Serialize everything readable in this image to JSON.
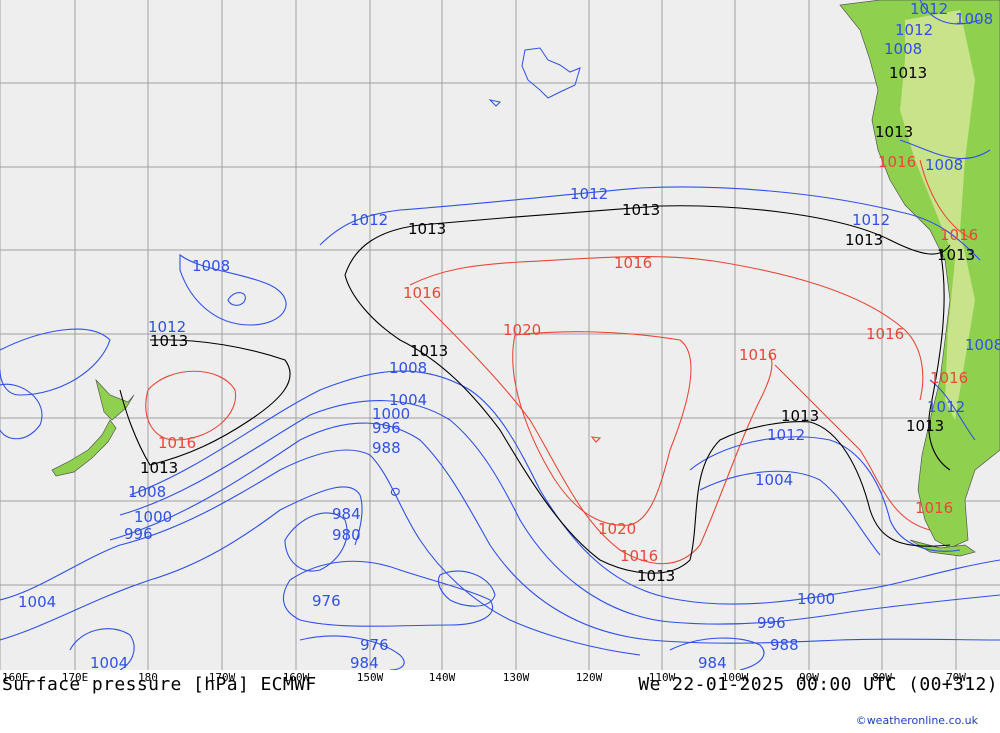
{
  "title": "Surface pressure [hPa] ECMWF",
  "valid_time": "We 22-01-2025 00:00 UTC (00+312)",
  "credit": "©weatheronline.co.uk",
  "longitude_ticks": [
    "160E",
    "170E",
    "180",
    "170W",
    "160W",
    "150W",
    "140W",
    "130W",
    "120W",
    "110W",
    "100W",
    "90W",
    "80W",
    "70W"
  ],
  "colors": {
    "isobar_low": "#3050e8",
    "isobar_high": "#e84838",
    "isobar_1013": "#000000",
    "land": "#8fd14f",
    "sea": "#eeeeee",
    "grid": "#a0a0a0"
  },
  "isobar_labels": {
    "blue": [
      "1012",
      "1008",
      "1012",
      "1012",
      "1012",
      "1008",
      "1004",
      "1000",
      "996",
      "988",
      "1008",
      "1000",
      "996",
      "1004",
      "984",
      "980",
      "976",
      "976",
      "984",
      "1004",
      "1012",
      "1004",
      "1000",
      "996",
      "988",
      "984",
      "1008",
      "1012",
      "1008",
      "1012",
      "1008",
      "1012",
      "1008"
    ],
    "red": [
      "1016",
      "1020",
      "1016",
      "1016",
      "1016",
      "1020",
      "1016",
      "1016",
      "1016",
      "1016",
      "1016",
      "1016"
    ],
    "black": [
      "1013",
      "1013",
      "1013",
      "1013",
      "1013",
      "1013",
      "1013",
      "1013",
      "1013",
      "1013",
      "1013",
      "1013"
    ]
  }
}
